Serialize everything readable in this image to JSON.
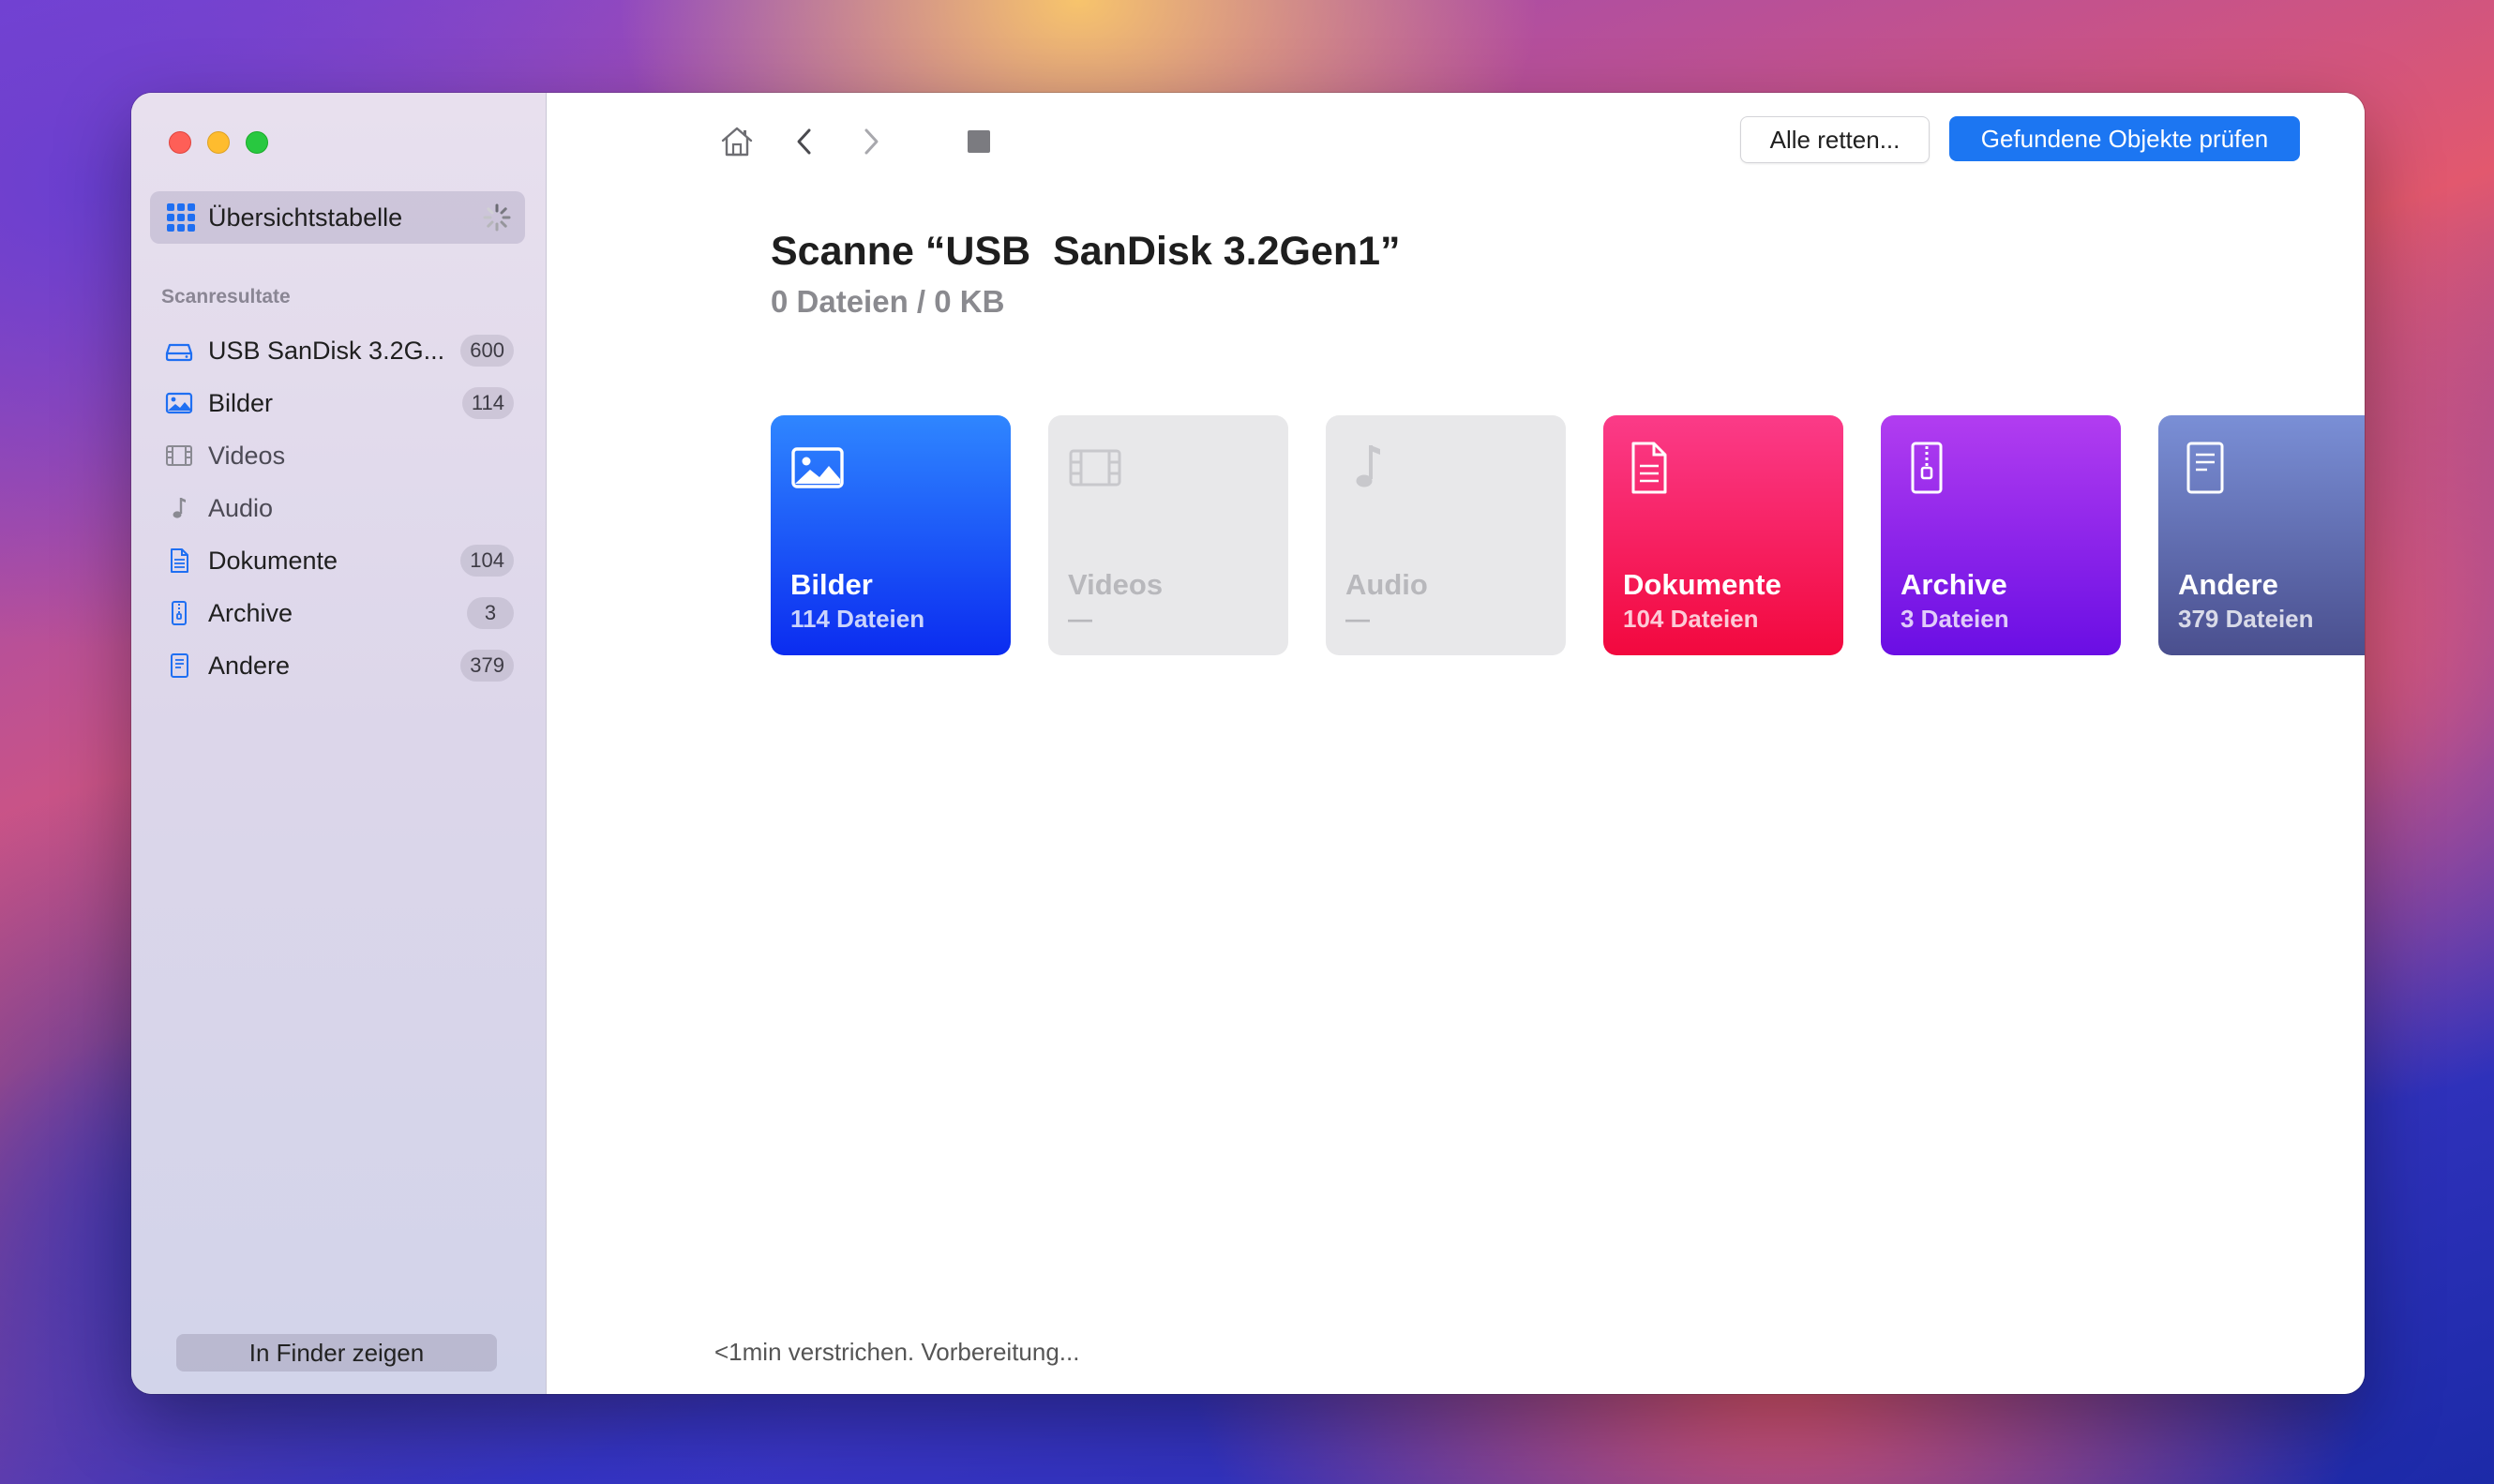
{
  "sidebar": {
    "overview_label": "Übersichtstabelle",
    "section_title": "Scanresultate",
    "items": [
      {
        "label": "USB  SanDisk 3.2G...",
        "count": "600",
        "icon": "drive-icon"
      },
      {
        "label": "Bilder",
        "count": "114",
        "icon": "image-icon"
      },
      {
        "label": "Videos",
        "count": "",
        "icon": "film-icon"
      },
      {
        "label": "Audio",
        "count": "",
        "icon": "music-note-icon"
      },
      {
        "label": "Dokumente",
        "count": "104",
        "icon": "document-icon"
      },
      {
        "label": "Archive",
        "count": "3",
        "icon": "zip-archive-icon"
      },
      {
        "label": "Andere",
        "count": "379",
        "icon": "other-file-icon"
      }
    ],
    "finder_button": "In Finder zeigen"
  },
  "toolbar": {
    "rescue_all": "Alle retten...",
    "review_found": "Gefundene Objekte prüfen"
  },
  "scan": {
    "title": "Scanne “USB  SanDisk 3.2Gen1”",
    "subtitle": "0 Dateien / 0 KB"
  },
  "cards": [
    {
      "name": "Bilder",
      "count": "114 Dateien"
    },
    {
      "name": "Videos",
      "count": "—"
    },
    {
      "name": "Audio",
      "count": "—"
    },
    {
      "name": "Dokumente",
      "count": "104 Dateien"
    },
    {
      "name": "Archive",
      "count": "3 Dateien"
    },
    {
      "name": "Andere",
      "count": "379 Dateien"
    }
  ],
  "status": "<1min verstrichen. Vorbereitung...",
  "colors": {
    "accent": "#1c76f2",
    "bilder": "#0b2cf0",
    "dokumente": "#f2083e",
    "archive": "#6a0ee4",
    "andere": "#4a4f8e"
  }
}
